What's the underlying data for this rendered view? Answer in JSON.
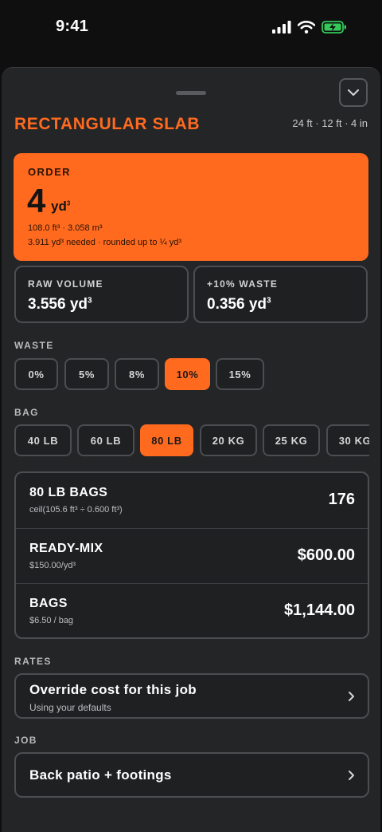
{
  "status": {
    "time": "9:41"
  },
  "header": {
    "title": "RECTANGULAR SLAB",
    "dimensions": "24 ft · 12 ft · 4 in"
  },
  "order": {
    "label": "ORDER",
    "value": "4",
    "unit": "yd",
    "unit_power": "3",
    "volumes": "108.0 ft³ · 3.058 m³",
    "needed": "3.911 yd³ needed · rounded up to ¼ yd³"
  },
  "stats": {
    "raw_label": "RAW VOLUME",
    "raw_value": "3.556 yd",
    "raw_power": "3",
    "waste_label": "+10% WASTE",
    "waste_value": "0.356 yd",
    "waste_power": "3"
  },
  "waste": {
    "label": "WASTE",
    "options": [
      "0%",
      "5%",
      "8%",
      "10%",
      "15%"
    ],
    "selected": "10%"
  },
  "bag": {
    "label": "BAG",
    "options": [
      "40 LB",
      "60 LB",
      "80 LB",
      "20 KG",
      "25 KG",
      "30 KG"
    ],
    "selected": "80 LB"
  },
  "costs": {
    "bags_count_title": "80 LB BAGS",
    "bags_count_formula": "ceil(105.6 ft³ ÷ 0.600 ft³)",
    "bags_count_value": "176",
    "readymix_title": "READY-MIX",
    "readymix_rate": "$150.00/yd³",
    "readymix_value": "$600.00",
    "bags_title": "BAGS",
    "bags_rate": "$6.50 / bag",
    "bags_value": "$1,144.00"
  },
  "rates": {
    "label": "RATES",
    "title": "Override cost for this job",
    "subtitle": "Using your defaults"
  },
  "job": {
    "label": "JOB",
    "title": "Back patio + footings"
  },
  "colors": {
    "accent": "#ff6a1f",
    "surface": "#242527",
    "background": "#0f0f10"
  }
}
